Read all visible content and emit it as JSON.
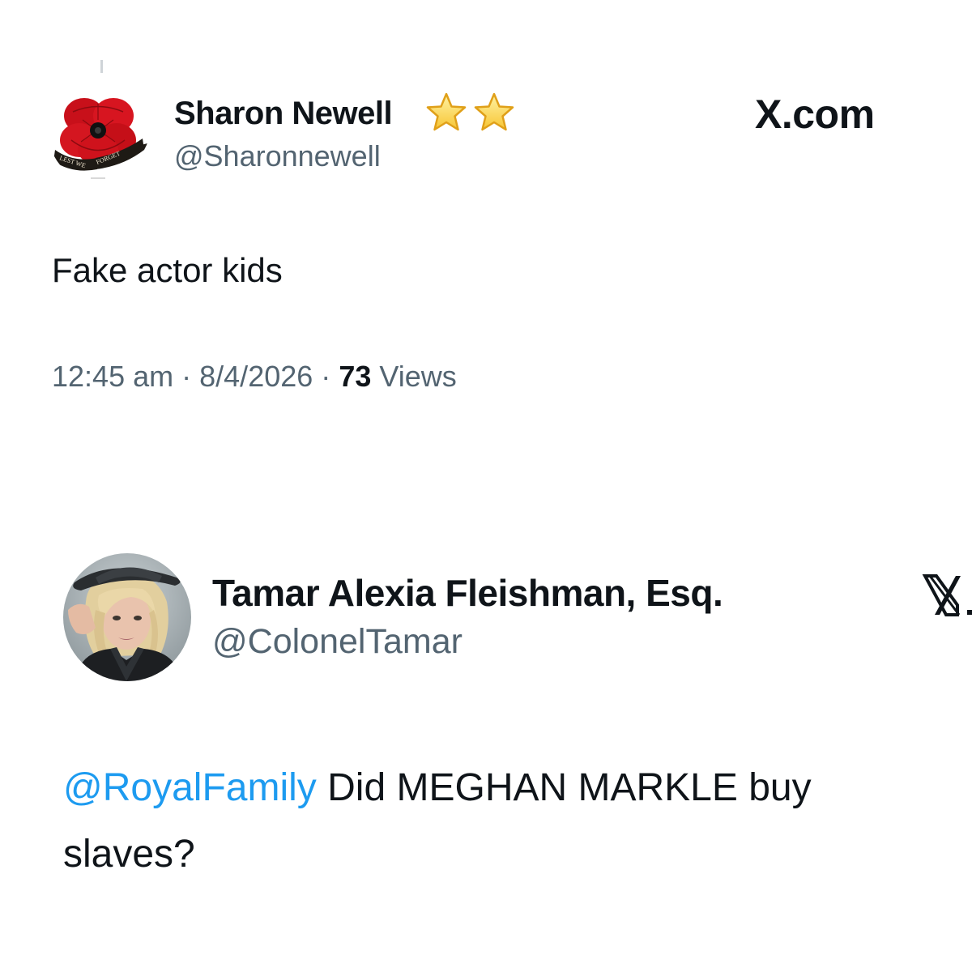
{
  "tweets": [
    {
      "display_name": "Sharon Newell",
      "name_badges": "two-star-emoji",
      "handle": "@Sharonnewell",
      "avatar": {
        "icon": "poppy-pin-icon",
        "banner_text": "LEST WE FORGET"
      },
      "brand": "X.com",
      "text": "Fake actor kids",
      "time": "12:45 am",
      "separator": "·",
      "date": "8/4/2026",
      "views_count": "73",
      "views_label": "Views"
    },
    {
      "display_name": "Tamar Alexia Fleishman, Esq.",
      "handle": "@ColonelTamar",
      "avatar": {
        "icon": "profile-photo"
      },
      "brand": "X.com",
      "mention": "@RoyalFamily",
      "text_line1": " Did MEGHAN MARKLE buy",
      "text_line2": "slaves?"
    }
  ],
  "colors": {
    "text_primary": "#0f1419",
    "text_secondary": "#536471",
    "mention": "#1d9bf0",
    "poppy_red": "#d0111b"
  }
}
